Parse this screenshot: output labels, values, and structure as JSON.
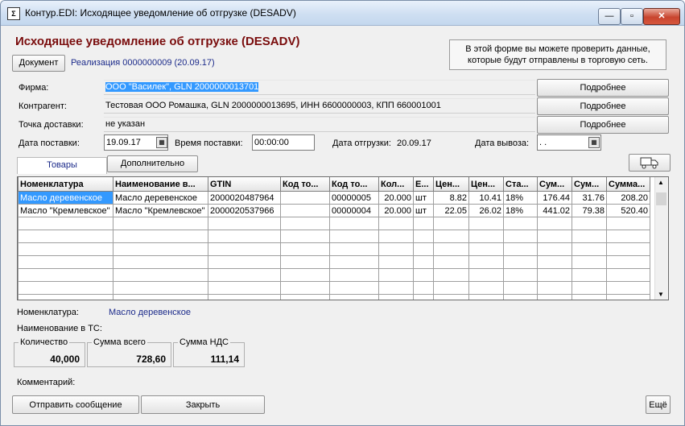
{
  "window": {
    "title": "Контур.EDI: Исходящее уведомление об отгрузке (DESADV)",
    "icon": "document-icon",
    "min_glyph": "—",
    "max_glyph": "▫",
    "close_glyph": "✕"
  },
  "header": {
    "title": "Исходящее уведомление об отгрузке (DESADV)",
    "document_button": "Документ",
    "realization_link": "Реализация  0000000009 (20.09.17)",
    "info_line1": "В этой форме вы можете проверить данные,",
    "info_line2": "которые будут отправлены в торговую сеть."
  },
  "form": {
    "firm_label": "Фирма:",
    "firm_value": "ООО \"Василек\", GLN 2000000013701",
    "contractor_label": "Контрагент:",
    "contractor_value": "Тестовая ООО Ромашка, GLN 2000000013695, ИНН 6600000003, КПП 660001001",
    "delivery_point_label": "Точка доставки:",
    "delivery_point_value": "не указан",
    "details_button": "Подробнее",
    "delivery_date_label": "Дата поставки:",
    "delivery_date_value": "19.09.17",
    "delivery_time_label": "Время поставки:",
    "delivery_time_value": "00:00:00",
    "shipment_date_label": "Дата отгрузки:",
    "shipment_date_value": "20.09.17",
    "pickup_date_label": "Дата вывоза:",
    "pickup_date_value": " .  ."
  },
  "tabs": {
    "goods": "Товары",
    "additional": "Дополнительно"
  },
  "table": {
    "headers": [
      "Номенклатура",
      "Наименование в...",
      "GTIN",
      "Код то...",
      "Код то...",
      "Кол...",
      "Е...",
      "Цен...",
      "Цен...",
      "Ста...",
      "Сум...",
      "Сум...",
      "Сумма..."
    ],
    "rows": [
      [
        "Масло деревенское",
        "Масло деревенское",
        "2000020487964",
        "",
        "00000005",
        "20.000",
        "шт",
        "8.82",
        "10.41",
        "18%",
        "176.44",
        "31.76",
        "208.20"
      ],
      [
        "Масло \"Кремлевское\"",
        "Масло \"Кремлевское\"",
        "2000020537966",
        "",
        "00000004",
        "20.000",
        "шт",
        "22.05",
        "26.02",
        "18%",
        "441.02",
        "79.38",
        "520.40"
      ]
    ]
  },
  "details": {
    "nomenclature_label": "Номенклатура:",
    "nomenclature_value": "Масло деревенское",
    "ts_name_label": "Наименование в ТС:",
    "quantity_label": "Количество",
    "quantity_value": "40,000",
    "total_label": "Сумма всего",
    "total_value": "728,60",
    "vat_label": "Сумма НДС",
    "vat_value": "111,14",
    "comment_label": "Комментарий:"
  },
  "footer": {
    "send_button": "Отправить сообщение",
    "close_button": "Закрыть",
    "more_button": "Ещё"
  }
}
